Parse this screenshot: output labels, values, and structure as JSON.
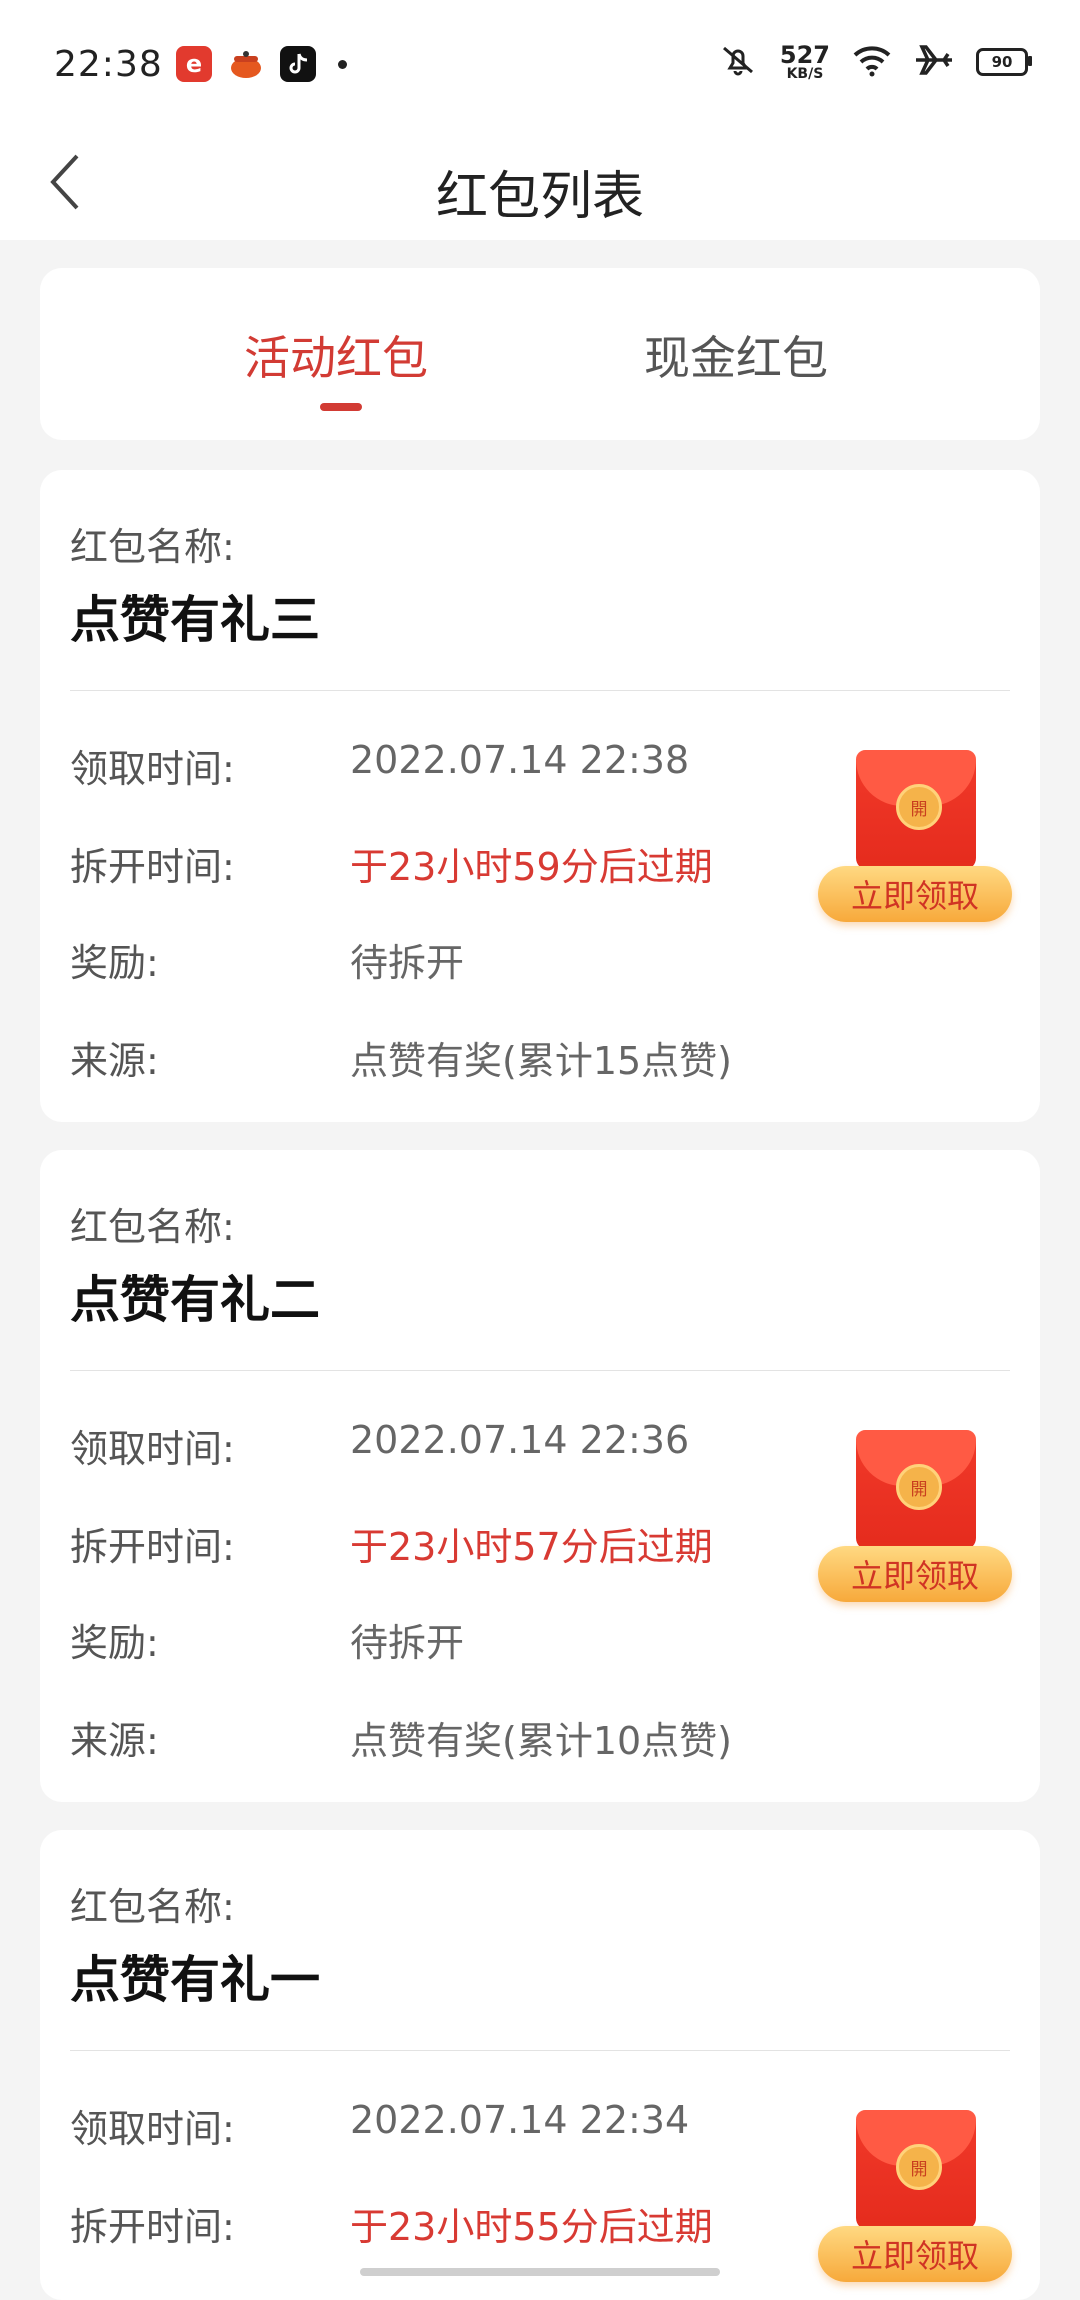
{
  "status_bar": {
    "time": "22:38",
    "app_icons": [
      "e-app-icon",
      "pot-app-icon",
      "tiktok-app-icon"
    ],
    "net_speed_value": "527",
    "net_speed_unit": "KB/S",
    "battery": "90",
    "icons": [
      "mute-icon",
      "wifi-icon",
      "airplane-icon",
      "battery-icon"
    ]
  },
  "header": {
    "title": "红包列表",
    "back_icon": "chevron-left-icon"
  },
  "tabs": [
    {
      "label": "活动红包",
      "active": true
    },
    {
      "label": "现金红包",
      "active": false
    }
  ],
  "field_labels": {
    "name": "红包名称:",
    "receive_time": "领取时间:",
    "open_time": "拆开时间:",
    "reward": "奖励:",
    "source": "来源:"
  },
  "envelopes": [
    {
      "name": "点赞有礼三",
      "receive_time": "2022.07.14 22:38",
      "open_time": "于23小时59分后过期",
      "reward": "待拆开",
      "source": "点赞有奖(累计15点赞)",
      "seal": "開",
      "button": "立即领取"
    },
    {
      "name": "点赞有礼二",
      "receive_time": "2022.07.14 22:36",
      "open_time": "于23小时57分后过期",
      "reward": "待拆开",
      "source": "点赞有奖(累计10点赞)",
      "seal": "開",
      "button": "立即领取"
    },
    {
      "name": "点赞有礼一",
      "receive_time": "2022.07.14 22:34",
      "open_time": "于23小时55分后过期",
      "seal": "開",
      "button": "立即领取"
    }
  ],
  "colors": {
    "accent": "#d23b34",
    "background": "#f4f4f4",
    "button_gradient_top": "#ffd982",
    "button_gradient_bottom": "#f7a93b"
  }
}
